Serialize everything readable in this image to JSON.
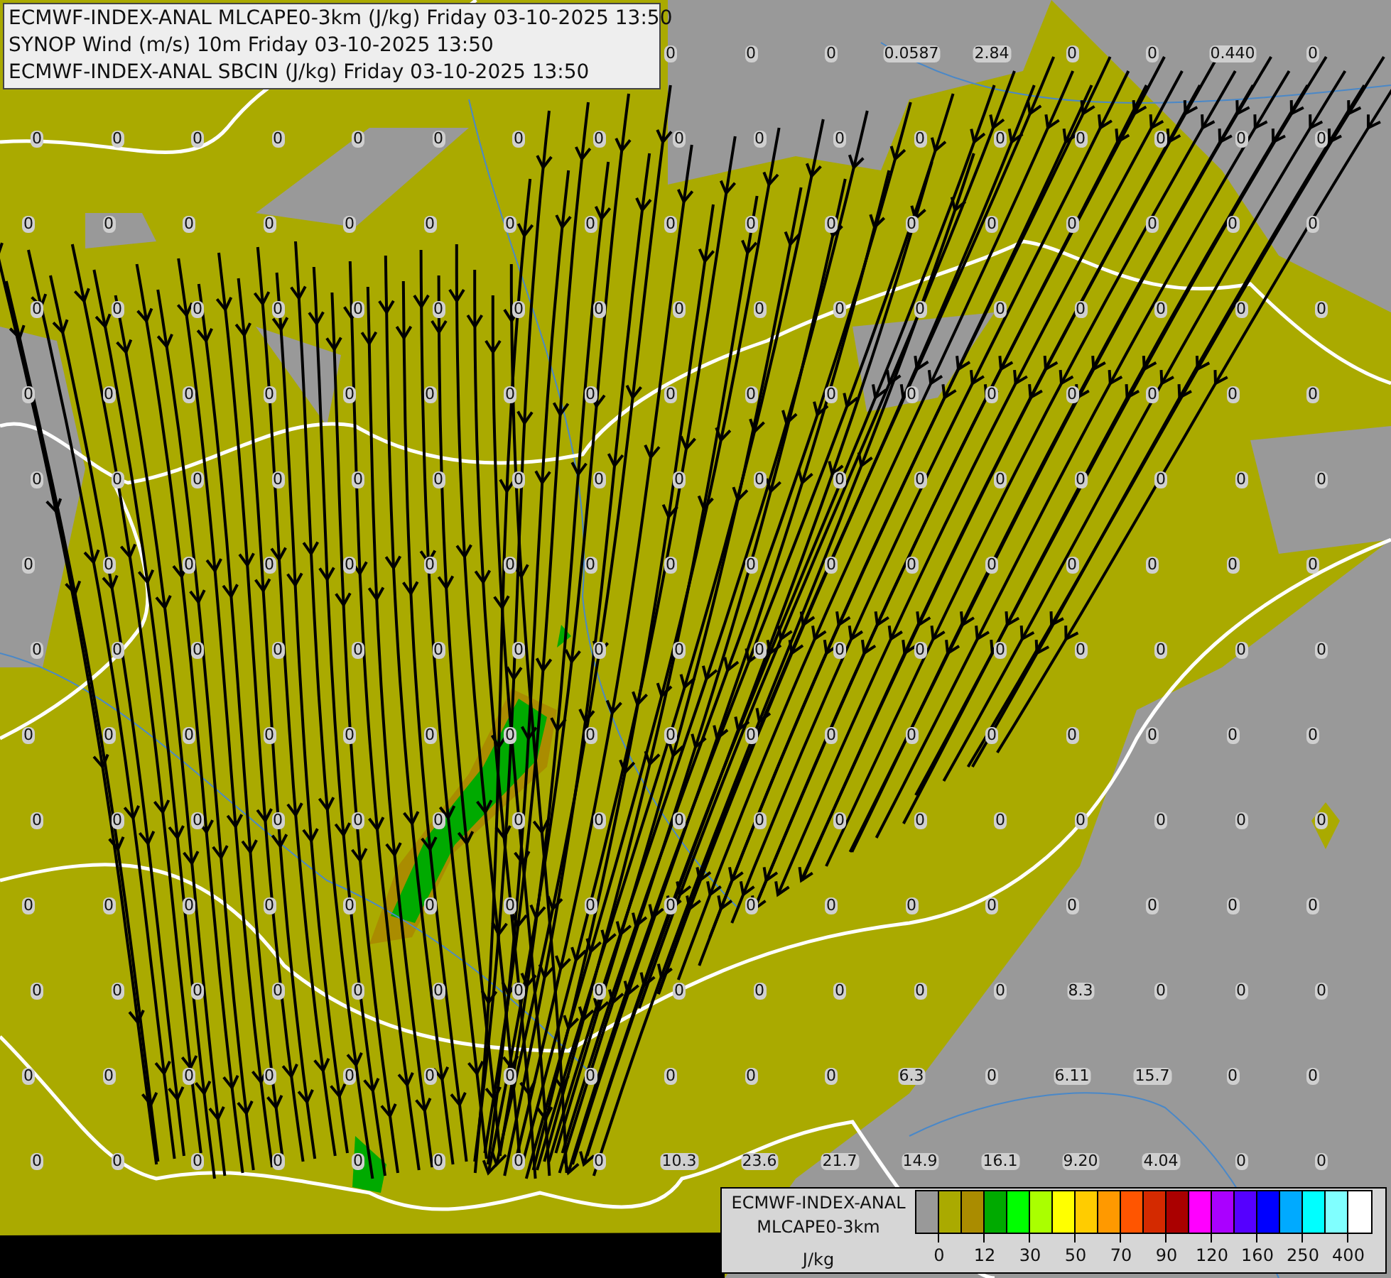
{
  "header": {
    "lines": [
      "ECMWF-INDEX-ANAL MLCAPE0-3km (J/kg) Friday 03-10-2025 13:50",
      "SYNOP Wind (m/s) 10m Friday 03-10-2025 13:50",
      "ECMWF-INDEX-ANAL SBCIN (J/kg) Friday 03-10-2025 13:50"
    ]
  },
  "stations": [
    [
      "0",
      "0",
      "0",
      "0.0587",
      "2.84",
      "0",
      "0",
      "0.440",
      "0"
    ],
    [
      "0",
      "0",
      "0",
      "0",
      "0",
      "0",
      "0",
      "0",
      "0",
      "0",
      "0",
      "0",
      "0",
      "0",
      "0",
      "0",
      "0"
    ],
    [
      "0",
      "0",
      "0",
      "0",
      "0",
      "0",
      "0",
      "0",
      "0",
      "0",
      "0",
      "0",
      "0",
      "0",
      "0",
      "0",
      "0"
    ],
    [
      "0",
      "0",
      "0",
      "0",
      "0",
      "0",
      "0",
      "0",
      "0",
      "0",
      "0",
      "0",
      "0",
      "0",
      "0",
      "0",
      "0"
    ],
    [
      "0",
      "0",
      "0",
      "0",
      "0",
      "0",
      "0",
      "0",
      "0",
      "0",
      "0",
      "0",
      "0",
      "0",
      "0",
      "0",
      "0"
    ],
    [
      "0",
      "0",
      "0",
      "0",
      "0",
      "0",
      "0",
      "0",
      "0",
      "0",
      "0",
      "0",
      "0",
      "0",
      "0",
      "0",
      "0"
    ],
    [
      "0",
      "0",
      "0",
      "0",
      "0",
      "0",
      "0",
      "0",
      "0",
      "0",
      "0",
      "0",
      "0",
      "0",
      "0",
      "0",
      "0"
    ],
    [
      "0",
      "0",
      "0",
      "0",
      "0",
      "0",
      "0",
      "0",
      "0",
      "0",
      "0",
      "0",
      "0",
      "0",
      "0",
      "0",
      "0"
    ],
    [
      "0",
      "0",
      "0",
      "0",
      "0",
      "0",
      "0",
      "0",
      "0",
      "0",
      "0",
      "0",
      "0",
      "0",
      "0",
      "0",
      "0"
    ],
    [
      "0",
      "0",
      "0",
      "0",
      "0",
      "0",
      "0",
      "0",
      "0",
      "0",
      "0",
      "0",
      "0",
      "0",
      "0",
      "0",
      "0"
    ],
    [
      "0",
      "0",
      "0",
      "0",
      "0",
      "0",
      "0",
      "0",
      "0",
      "0",
      "0",
      "0",
      "0",
      "0",
      "0",
      "0",
      "0"
    ],
    [
      "0",
      "0",
      "0",
      "0",
      "0",
      "0",
      "0",
      "0",
      "0",
      "0",
      "0",
      "0",
      "0",
      "8.3",
      "0",
      "0",
      "0"
    ],
    [
      "0",
      "0",
      "0",
      "0",
      "0",
      "0",
      "0",
      "0",
      "0",
      "0",
      "0",
      "6.3",
      "0",
      "6.11",
      "15.7",
      "0",
      "0"
    ],
    [
      "0",
      "0",
      "0",
      "0",
      "0",
      "0",
      "0",
      "0",
      "10.3",
      "23.6",
      "21.7",
      "14.9",
      "16.1",
      "9.20",
      "4.04",
      "0",
      "0"
    ]
  ],
  "legend": {
    "title_lines": [
      "ECMWF-INDEX-ANAL",
      "MLCAPE0-3km"
    ],
    "unit": "J/kg",
    "swatches": [
      {
        "color": "#999999"
      },
      {
        "color": "#aaaa00"
      },
      {
        "color": "#aa8c00"
      },
      {
        "color": "#00aa00"
      },
      {
        "color": "#00ff00"
      },
      {
        "color": "#aaff00"
      },
      {
        "color": "#ffff00"
      },
      {
        "color": "#ffcc00"
      },
      {
        "color": "#ff9900"
      },
      {
        "color": "#ff5500"
      },
      {
        "color": "#d42a00"
      },
      {
        "color": "#aa0000"
      },
      {
        "color": "#ff00ff"
      },
      {
        "color": "#aa00ff"
      },
      {
        "color": "#5500ff"
      },
      {
        "color": "#0000ff"
      },
      {
        "color": "#00aaff"
      },
      {
        "color": "#00ffff"
      },
      {
        "color": "#80ffff"
      },
      {
        "color": "#ffffff"
      }
    ],
    "ticks": [
      "0",
      "12",
      "30",
      "50",
      "70",
      "90",
      "120",
      "160",
      "250",
      "400"
    ]
  }
}
